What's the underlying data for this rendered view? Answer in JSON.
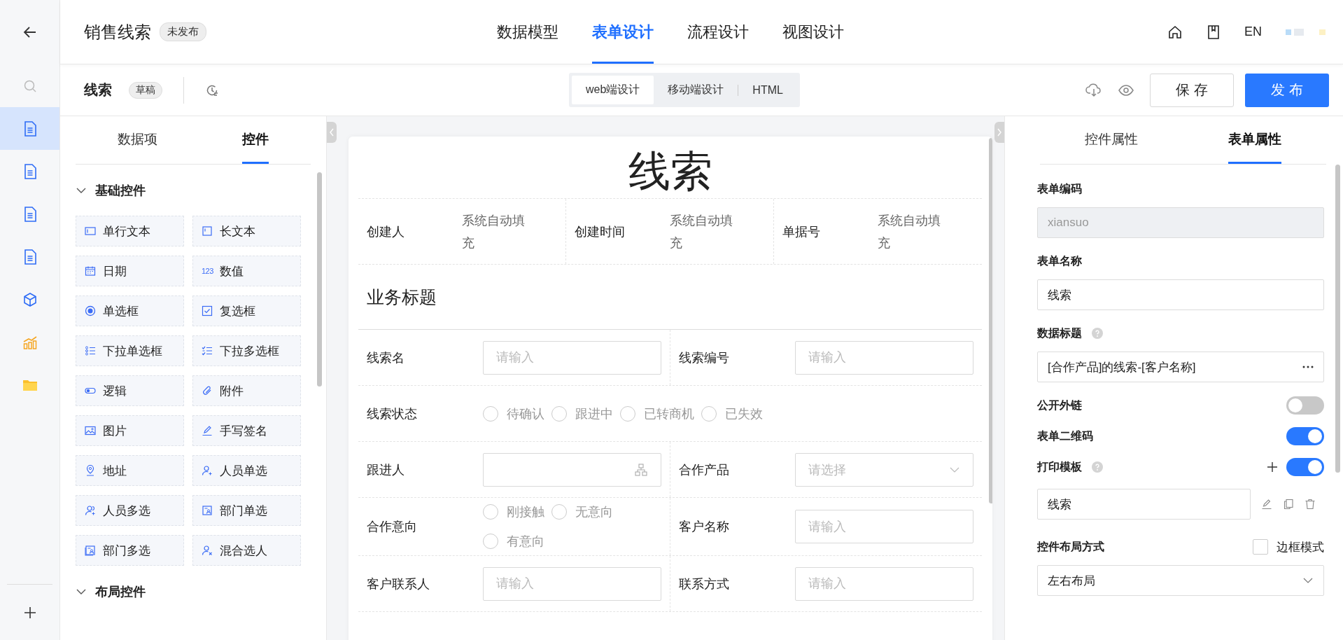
{
  "rail": [
    {
      "kind": "search",
      "selected": false
    },
    {
      "kind": "document",
      "selected": true
    },
    {
      "kind": "document",
      "selected": false
    },
    {
      "kind": "document",
      "selected": false
    },
    {
      "kind": "document",
      "selected": false
    },
    {
      "kind": "cube",
      "selected": false
    },
    {
      "kind": "chart",
      "selected": false
    },
    {
      "kind": "folder",
      "selected": false
    }
  ],
  "app": {
    "title": "销售线索",
    "badge": "未发布",
    "language": "EN"
  },
  "nav_tabs": [
    {
      "label": "数据模型",
      "selected": false
    },
    {
      "label": "表单设计",
      "selected": true
    },
    {
      "label": "流程设计",
      "selected": false
    },
    {
      "label": "视图设计",
      "selected": false
    }
  ],
  "toolbar": {
    "title": "线索",
    "badge": "草稿",
    "modes": [
      {
        "label": "web端设计",
        "selected": true
      },
      {
        "label": "移动端设计",
        "selected": false
      },
      {
        "label": "HTML",
        "selected": false
      }
    ],
    "save": "保 存",
    "publish": "发 布"
  },
  "left_panel": {
    "tabs": [
      {
        "label": "数据项",
        "selected": false
      },
      {
        "label": "控件",
        "selected": true
      }
    ],
    "groups": [
      {
        "title": "基础控件",
        "expanded": true,
        "items": [
          {
            "label": "单行文本",
            "kind": "textline"
          },
          {
            "label": "长文本",
            "kind": "textarea"
          },
          {
            "label": "日期",
            "kind": "date"
          },
          {
            "label": "数值",
            "kind": "number",
            "glyph": "123"
          },
          {
            "label": "单选框",
            "kind": "radio"
          },
          {
            "label": "复选框",
            "kind": "checkbox"
          },
          {
            "label": "下拉单选框",
            "kind": "list"
          },
          {
            "label": "下拉多选框",
            "kind": "checklist"
          },
          {
            "label": "逻辑",
            "kind": "toggle"
          },
          {
            "label": "附件",
            "kind": "paperclip"
          },
          {
            "label": "图片",
            "kind": "image"
          },
          {
            "label": "手写签名",
            "kind": "pen"
          },
          {
            "label": "地址",
            "kind": "pin"
          },
          {
            "label": "人员单选",
            "kind": "user"
          },
          {
            "label": "人员多选",
            "kind": "users"
          },
          {
            "label": "部门单选",
            "kind": "dept"
          },
          {
            "label": "部门多选",
            "kind": "depts"
          },
          {
            "label": "混合选人",
            "kind": "mixed"
          }
        ]
      },
      {
        "title": "布局控件",
        "expanded": true
      }
    ]
  },
  "form": {
    "title": "线索",
    "system_fields": [
      {
        "label": "创建人",
        "value": "系统自动填充"
      },
      {
        "label": "创建时间",
        "value": "系统自动填充"
      },
      {
        "label": "单据号",
        "value": "系统自动填充"
      }
    ],
    "section": "业务标题",
    "rows": [
      [
        {
          "label": "线索名",
          "kind": "input",
          "placeholder": "请输入"
        },
        {
          "label": "线索编号",
          "kind": "input",
          "placeholder": "请输入"
        }
      ],
      [
        {
          "label": "线索状态",
          "kind": "radio",
          "options": [
            {
              "label": "待确认",
              "selected": false
            },
            {
              "label": "跟进中",
              "selected": false
            },
            {
              "label": "已转商机",
              "selected": false
            },
            {
              "label": "已失效",
              "selected": false
            }
          ]
        }
      ],
      [
        {
          "label": "跟进人",
          "kind": "org"
        },
        {
          "label": "合作产品",
          "kind": "select",
          "placeholder": "请选择"
        }
      ],
      [
        {
          "label": "合作意向",
          "kind": "radio",
          "options": [
            {
              "label": "刚接触",
              "selected": false
            },
            {
              "label": "无意向",
              "selected": false
            },
            {
              "label": "有意向",
              "selected": false
            }
          ]
        },
        {
          "label": "客户名称",
          "kind": "input",
          "placeholder": "请输入"
        }
      ],
      [
        {
          "label": "客户联系人",
          "kind": "input",
          "placeholder": "请输入"
        },
        {
          "label": "联系方式",
          "kind": "input",
          "placeholder": "请输入"
        }
      ]
    ]
  },
  "properties": {
    "tabs": [
      {
        "label": "控件属性",
        "selected": false
      },
      {
        "label": "表单属性",
        "selected": true
      }
    ],
    "items": [
      {
        "kind": "text",
        "label": "表单编码",
        "help": false,
        "value": "xiansuo",
        "disabled": true,
        "more": false
      },
      {
        "kind": "text",
        "label": "表单名称",
        "help": false,
        "value": "线索",
        "disabled": false,
        "more": false
      },
      {
        "kind": "text",
        "label": "数据标题",
        "help": true,
        "value": "[合作产品]的线索-[客户名称]",
        "disabled": false,
        "more": true
      },
      {
        "kind": "switch",
        "label": "公开外链",
        "help": false,
        "on": false,
        "add": false
      },
      {
        "kind": "switch",
        "label": "表单二维码",
        "help": false,
        "on": true,
        "add": false
      },
      {
        "kind": "switch",
        "label": "打印模板",
        "help": true,
        "on": true,
        "add": true
      },
      {
        "kind": "template",
        "value": "线索"
      },
      {
        "kind": "select",
        "label": "控件布局方式",
        "help": false,
        "value": "左右布局",
        "option": {
          "label": "边框模式",
          "checked": false
        }
      }
    ]
  }
}
